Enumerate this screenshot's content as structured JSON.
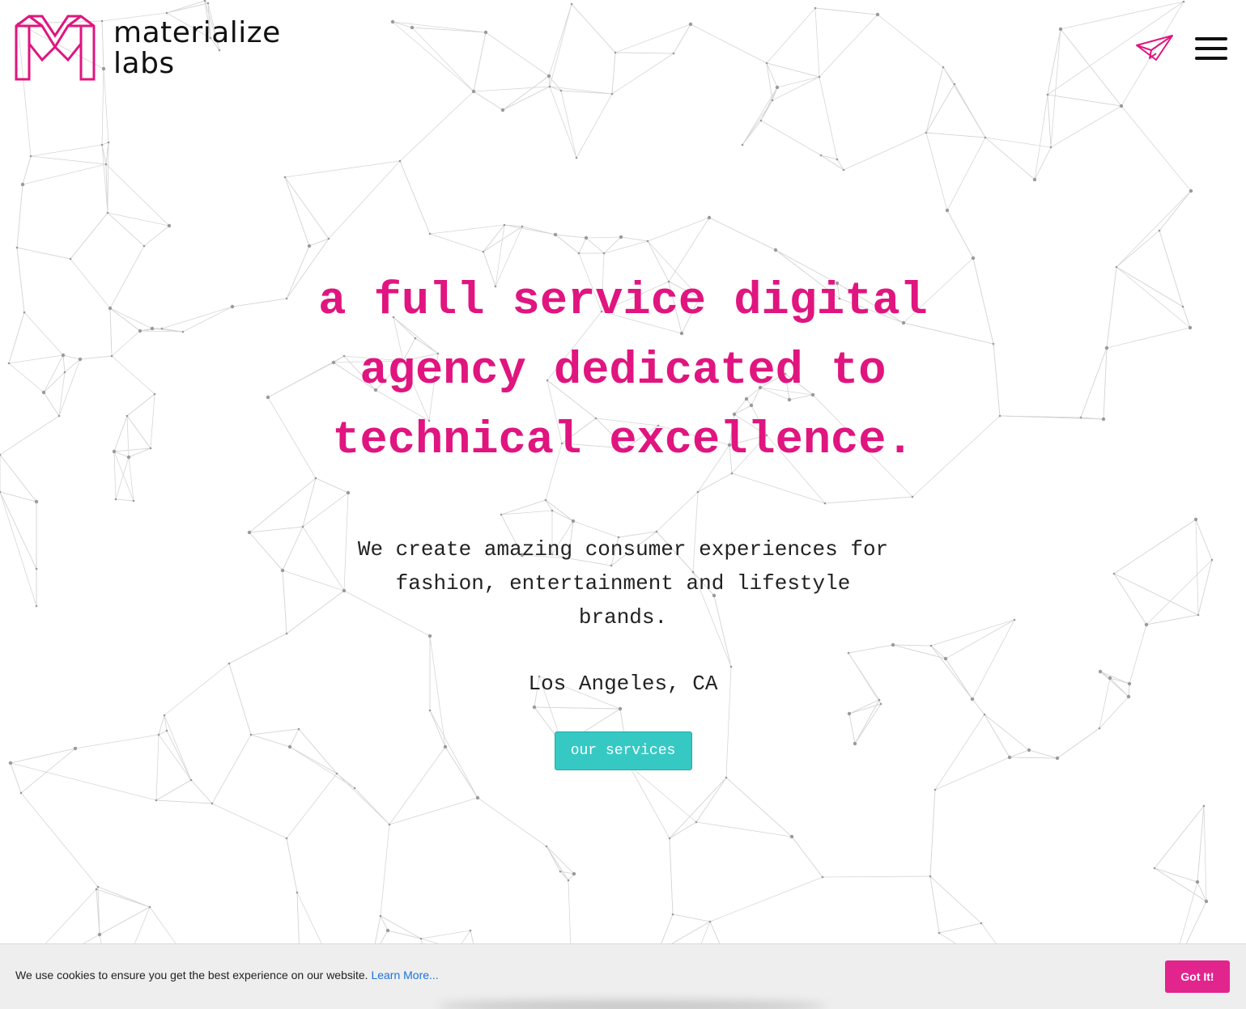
{
  "brand": {
    "name_line1": "materialize",
    "name_line2": "labs",
    "accent_color": "#e0157f",
    "logo_icon": "m-logo-icon"
  },
  "header": {
    "contact_icon": "paper-plane-icon",
    "menu_icon": "hamburger-menu-icon"
  },
  "hero": {
    "headline": "a full service digital agency dedicated to technical excellence.",
    "subtext": "We create amazing consumer experiences for fashion, entertainment and lifestyle brands.",
    "location": "Los Angeles, CA",
    "cta_label": "our services",
    "cta_color": "#36c9c4"
  },
  "cookie_banner": {
    "message": "We use cookies to ensure you get the best experience on our website.",
    "link_label": "Learn More...",
    "link_color": "#1a73d9",
    "button_label": "Got It!",
    "button_color": "#e2248d"
  }
}
